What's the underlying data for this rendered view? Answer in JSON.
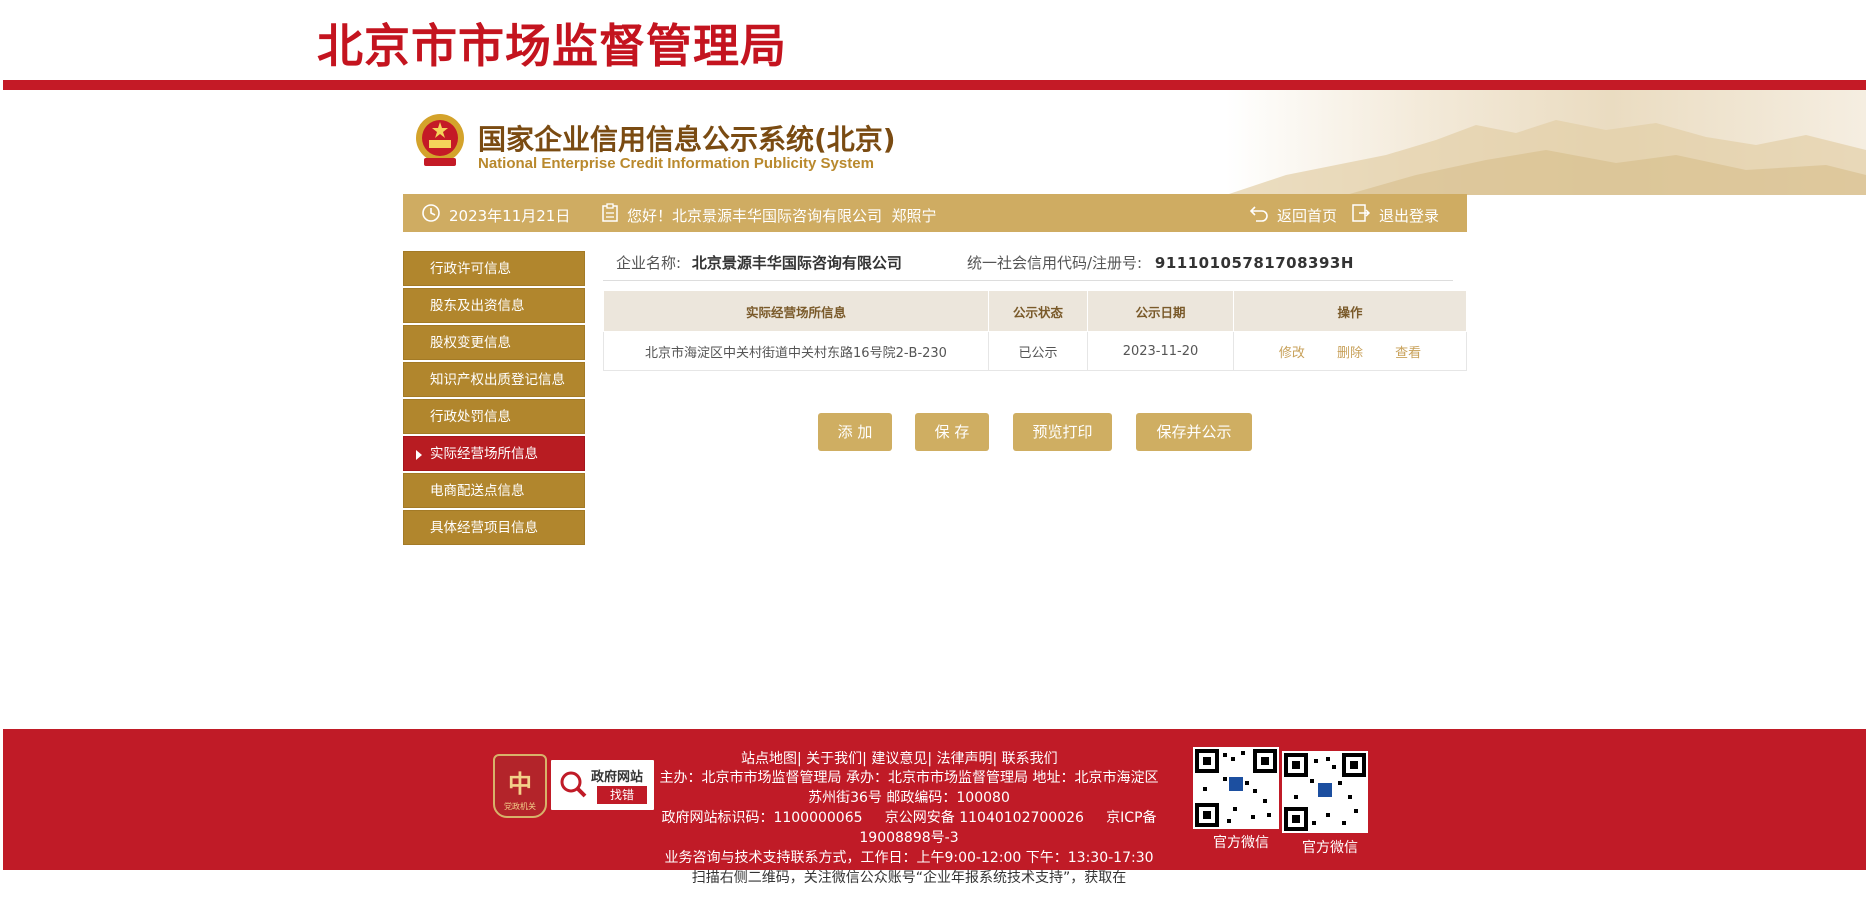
{
  "header": {
    "site_title": "北京市市场监督管理局",
    "system_title": "国家企业信用信息公示系统(北京)",
    "system_subtitle": "National Enterprise Credit Information Publicity System"
  },
  "infobar": {
    "date": "2023年11月21日",
    "greeting": "您好！北京景源丰华国际咨询有限公司  郑照宁",
    "home_link": "返回首页",
    "logout_link": "退出登录"
  },
  "sidebar": {
    "items": [
      {
        "label": "行政许可信息",
        "active": false
      },
      {
        "label": "股东及出资信息",
        "active": false
      },
      {
        "label": "股权变更信息",
        "active": false
      },
      {
        "label": "知识产权出质登记信息",
        "active": false
      },
      {
        "label": "行政处罚信息",
        "active": false
      },
      {
        "label": "实际经营场所信息",
        "active": true
      },
      {
        "label": "电商配送点信息",
        "active": false
      },
      {
        "label": "具体经营项目信息",
        "active": false
      }
    ]
  },
  "company": {
    "name_label": "企业名称:",
    "name": "北京景源丰华国际咨询有限公司",
    "credit_label": "统一社会信用代码/注册号:",
    "credit_code": "91110105781708393H"
  },
  "table": {
    "headers": [
      "实际经营场所信息",
      "公示状态",
      "公示日期",
      "操作"
    ],
    "rows": [
      {
        "address": "北京市海淀区中关村街道中关村东路16号院2-B-230",
        "status": "已公示",
        "date": "2023-11-20",
        "ops": [
          "修改",
          "删除",
          "查看"
        ]
      }
    ]
  },
  "buttons": {
    "add": "添 加",
    "save": "保 存",
    "preview_print": "预览打印",
    "save_publish": "保存并公示"
  },
  "footer": {
    "links": "站点地图| 关于我们| 建议意见| 法律声明| 联系我们",
    "host_line": "主办：北京市市场监督管理局 承办：北京市市场监督管理局 地址：北京市海淀区苏州街36号 邮政编码：100080",
    "id_line": "政府网站标识码：1100000065     京公网安备 11040102700026     京ICP备19008898号-3",
    "support_line": "业务咨询与技术支持联系方式，工作日：上午9:00-12:00 下午：13:30-17:30",
    "scan_line": "扫描右侧二维码，关注微信公众账号“企业年报系统技术支持”，获取在",
    "party_badge": "党政机关",
    "gov_badge_top": "政府网站",
    "gov_badge_bottom": "找错",
    "qr_label_1": "官方微信",
    "qr_label_2": "官方微信"
  },
  "colors": {
    "brand_red": "#c41a26",
    "gold": "#cfac62",
    "sidebar_gold": "#b1862d",
    "active_red": "#b81c22"
  }
}
